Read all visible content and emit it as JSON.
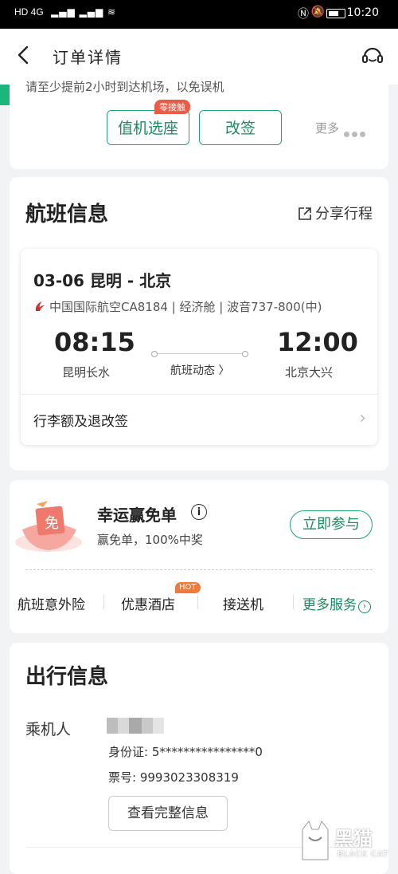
{
  "status_bar": {
    "network": "HD 4G",
    "time": "10:20"
  },
  "header": {
    "title": "订单详情"
  },
  "top_card": {
    "clipped_notice": "请至少提前2小时到达机场，以免误机",
    "checkin_label": "值机选座",
    "checkin_badge": "零接触",
    "change_label": "改签",
    "more_label": "更多"
  },
  "flight_section": {
    "title": "航班信息",
    "share_label": "分享行程",
    "date_route": "03-06 昆明 - 北京",
    "airline_info": "中国国际航空CA8184 | 经济舱 | 波音737-800(中)",
    "dep_time": "08:15",
    "dep_airport": "昆明长水",
    "arr_time": "12:00",
    "arr_airport": "北京大兴",
    "dynamics_label": "航班动态 〉",
    "luggage_label": "行李额及退改签"
  },
  "promo": {
    "title": "幸运赢免单",
    "info_icon": "i",
    "subtitle": "赢免单，100%中奖",
    "join_label": "立即参与",
    "gift_char": "免"
  },
  "services": {
    "items": [
      "航班意外险",
      "优惠酒店",
      "接送机"
    ],
    "hot_badge": "HOT",
    "more_label": "更多服务",
    "more_chevron": "›"
  },
  "travel_section": {
    "title": "出行信息",
    "passenger_label": "乘机人",
    "id_line": "身份证:  5****************0",
    "ticket_line": "票号:  9993023308319",
    "full_info_label": "查看完整信息"
  },
  "watermark": {
    "text": "黑猫",
    "en": "BLACK CAT"
  },
  "colors": {
    "accent": "#1ba672",
    "badge": "#e95c47",
    "hot": "#f07a3a"
  },
  "icons": {
    "back": "chevron-left-icon",
    "support": "customer-service-icon",
    "share": "share-external-icon",
    "airline": "air-china-logo-icon",
    "luggage_chevron": "chevron-right-icon"
  }
}
